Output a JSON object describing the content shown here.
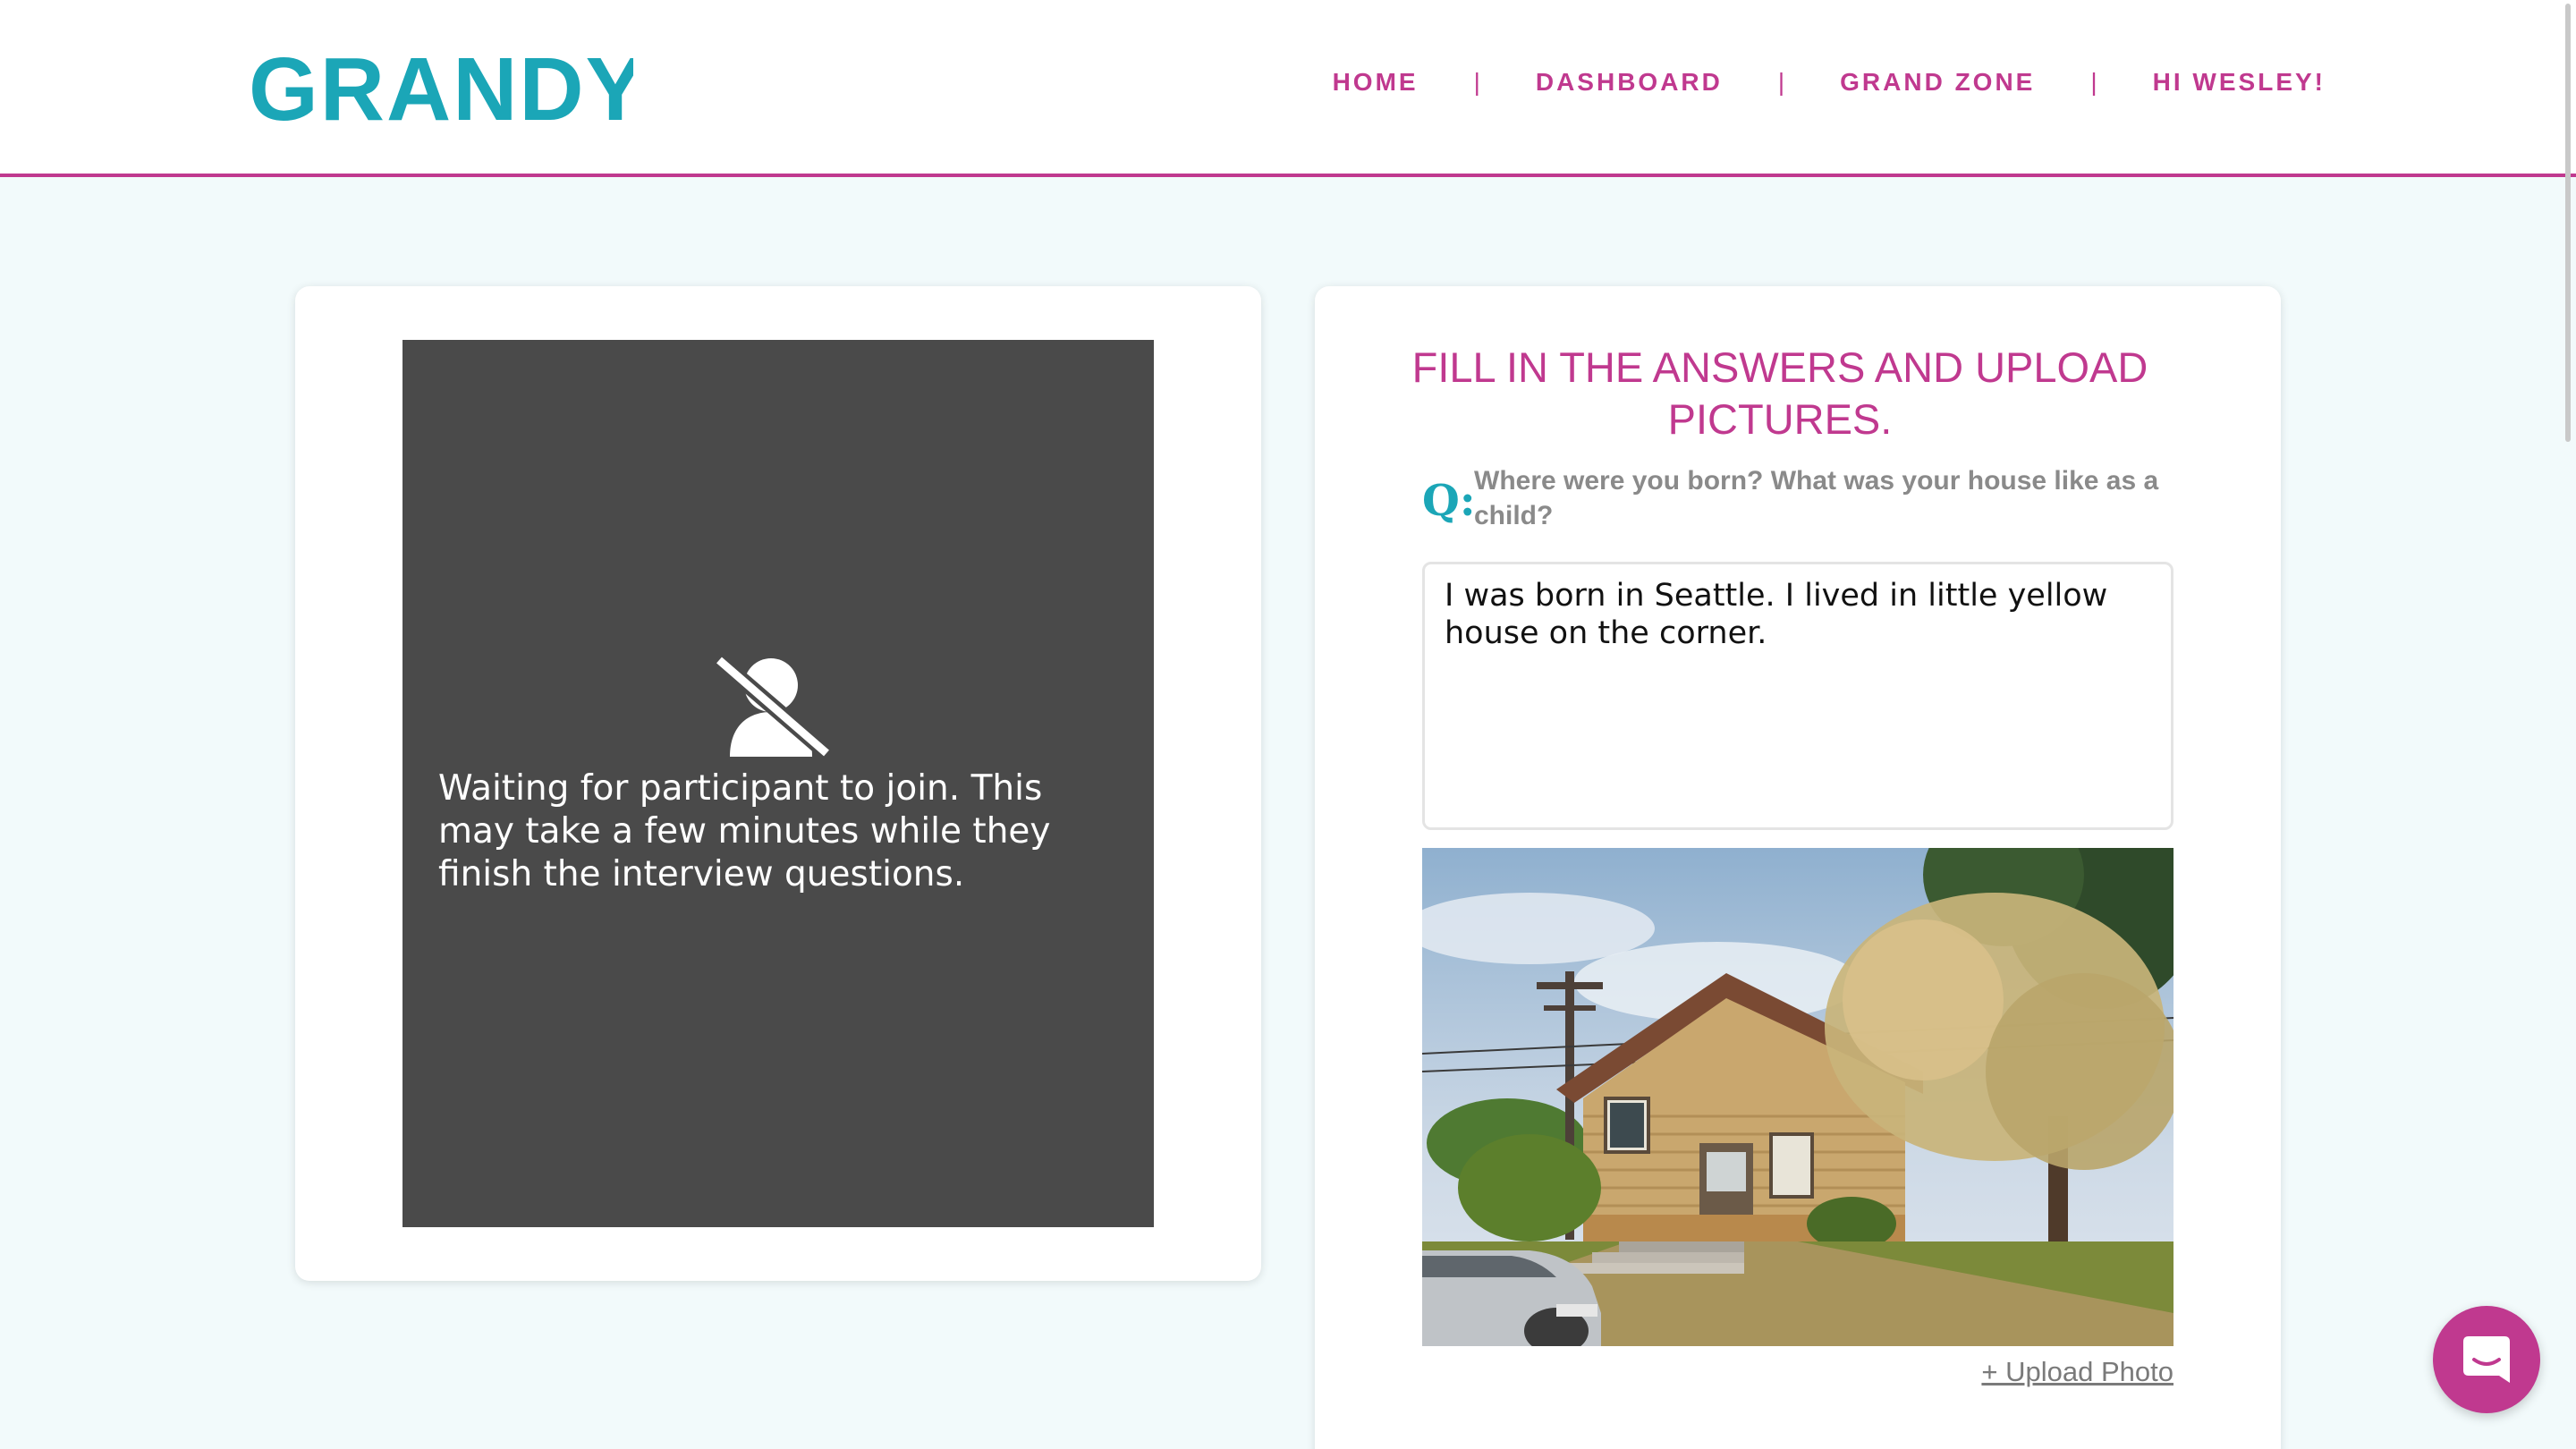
{
  "header": {
    "logo_text": "GRANDY",
    "nav": {
      "home": "HOME",
      "dashboard": "DASHBOARD",
      "grand_zone": "GRAND ZONE",
      "greeting": "HI WESLEY!",
      "separator": "|"
    }
  },
  "video_panel": {
    "icon": "no-user-icon",
    "waiting_message": "Waiting for participant to join. This may take a few minutes while they finish the interview questions."
  },
  "form_panel": {
    "title": "FILL IN THE ANSWERS AND UPLOAD PICTURES.",
    "q_label": "Q:",
    "question": "Where were you born? What was your house like as a child?",
    "answer": "I was born in Seattle. I lived in little yellow house on the corner.",
    "upload_label": "+ Upload Photo"
  },
  "colors": {
    "brand_pink": "#c0398f",
    "brand_teal": "#1ba6b7",
    "video_bg": "#4a4a4a",
    "page_bg": "#f2fafb"
  },
  "chat": {
    "icon": "chat-icon"
  }
}
